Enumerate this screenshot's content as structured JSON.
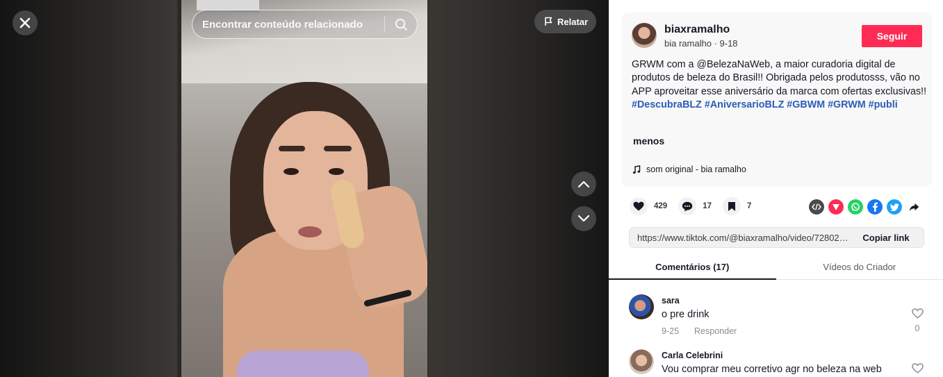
{
  "video": {
    "search": {
      "placeholder": "Encontrar conteúdo relacionado"
    },
    "report_label": "Relatar",
    "colors": {
      "panel_bg": "#2a2826",
      "overlay_button": "#545454"
    },
    "icons": [
      "close-icon",
      "search-icon",
      "flag-icon",
      "chevron-up-icon",
      "chevron-down-icon"
    ]
  },
  "author": {
    "username": "biaxramalho",
    "nickname": "bia ramalho",
    "date": "9-18",
    "follow_label": "Seguir"
  },
  "description": {
    "text": "GRWM com a @BelezaNaWeb, a maior curadoria digital de produtos de beleza do Brasil!! Obrigada pelos produtosss, vão no APP aproveitar esse aniversário da marca com ofertas exclusivas!!",
    "hashtags": [
      "#DescubraBLZ",
      "#AniversarioBLZ",
      "#GBWM",
      "#GRWM",
      "#publi"
    ],
    "less_label": "menos"
  },
  "music": {
    "label": "som original - bia ramalho"
  },
  "stats": {
    "likes": "429",
    "comments": "17",
    "favorites": "7"
  },
  "share_icons": [
    "embed-icon",
    "send-icon",
    "whatsapp-icon",
    "facebook-icon",
    "twitter-icon",
    "share-arrow-icon"
  ],
  "link": {
    "url": "https://www.tiktok.com/@biaxramalho/video/7280245...",
    "copy_label": "Copiar link"
  },
  "tabs": [
    {
      "label": "Comentários (17)",
      "active": true
    },
    {
      "label": "Vídeos do Criador",
      "active": false
    }
  ],
  "comments": [
    {
      "user": "sara",
      "text": "o pre drink",
      "date": "9-25",
      "reply_label": "Responder",
      "likes": "0"
    },
    {
      "user": "Carla Celebrini",
      "text": "Vou comprar meu corretivo agr no beleza na web"
    }
  ],
  "colors": {
    "accent": "#fe2c55",
    "hashtag": "#2b5db9",
    "text": "#161823",
    "muted": "#8a8b91"
  }
}
